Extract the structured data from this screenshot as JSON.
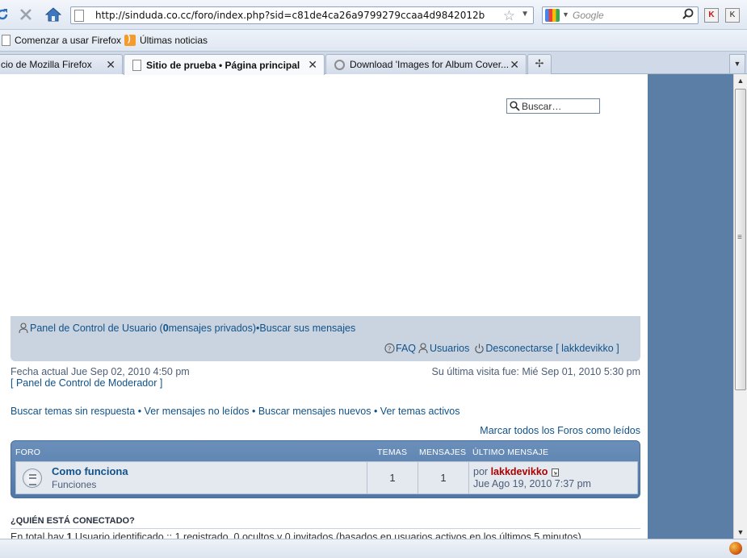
{
  "browser": {
    "url": "http://sinduda.co.cc/foro/index.php?sid=c81de4ca26a9799279ccaa4d9842012b",
    "search_placeholder": "Google"
  },
  "bookmarks": [
    "Comenzar a usar Firefox",
    "Últimas noticias"
  ],
  "tabs": [
    {
      "label": "cio de Mozilla Firefox"
    },
    {
      "label": "Sitio de prueba • Página principal"
    },
    {
      "label": "Download 'Images for Album Cover..."
    }
  ],
  "header": {
    "search_value": "Buscar…"
  },
  "nav": {
    "ucp_prefix": "Panel de Control de Usuario (",
    "pm_count": "0",
    "ucp_suffix": " mensajes privados)",
    "sep": " • ",
    "search_own": "Buscar sus mensajes",
    "faq": "FAQ",
    "users": "Usuarios",
    "logout": "Desconectarse [ lakkdevikko ]"
  },
  "info": {
    "current_date": "Fecha actual Jue Sep 02, 2010 4:50 pm",
    "last_visit": "Su última visita fue: Mié Sep 01, 2010 5:30 pm",
    "mod_panel": "[ Panel de Control de Moderador ]"
  },
  "search_links": "Buscar temas sin respuesta • Ver mensajes no leídos • Buscar mensajes nuevos • Ver temas activos",
  "mark_read": "Marcar todos los Foros como leídos",
  "forum_table": {
    "headers": {
      "forum": "FORO",
      "topics": "TEMAS",
      "posts": "MENSAJES",
      "last": "ÚLTIMO MENSAJE"
    },
    "rows": [
      {
        "name": "Como funciona",
        "desc": "Funciones",
        "topics": "1",
        "posts": "1",
        "last_by": "por",
        "last_user": "lakkdevikko",
        "last_date": "Jue Ago 19, 2010 7:37 pm"
      }
    ]
  },
  "online": {
    "title": "¿QUIÉN ESTÁ CONECTADO?",
    "text_prefix": "En total hay ",
    "count": "1",
    "text_suffix": " Usuario identificado :: 1 registrado, 0 ocultos y 0 invitados (basados en usuarios activos en los últimos 5 minutos)"
  },
  "colors": {
    "link": "#105289",
    "user_red": "#aa0000",
    "side_blue": "#5a7ea6"
  }
}
